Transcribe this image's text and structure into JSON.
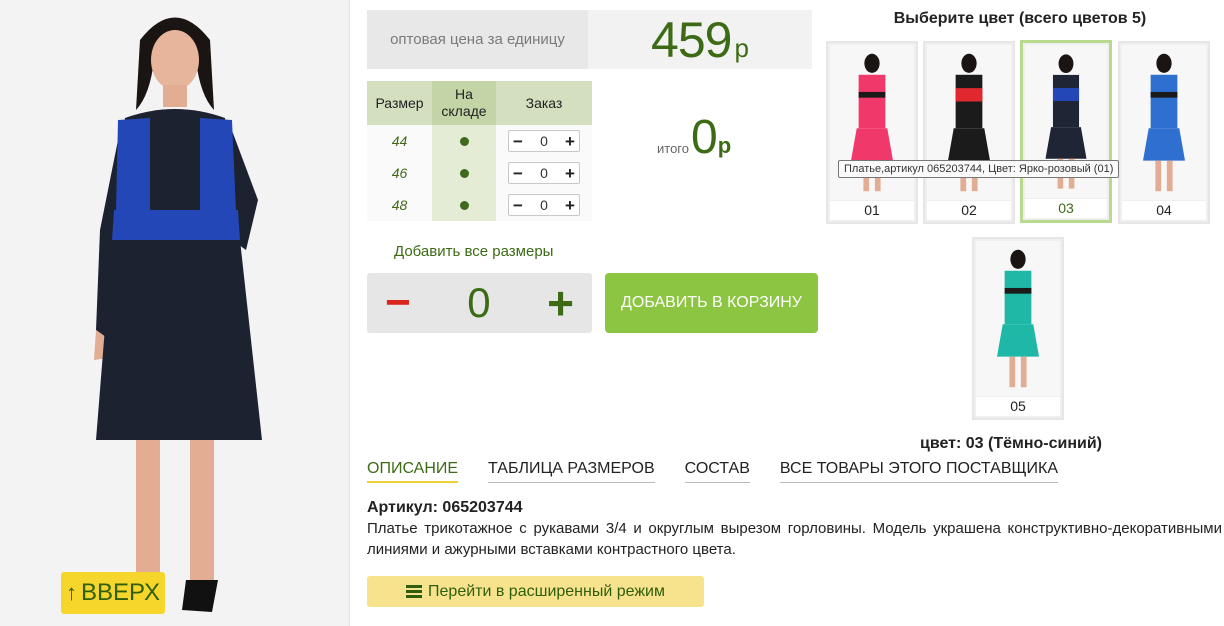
{
  "navigation": {
    "up_label": "ВВЕРХ",
    "up_icon": "arrow-up-icon"
  },
  "price": {
    "label": "оптовая цена за единицу",
    "value": "459",
    "currency": "р"
  },
  "size_table": {
    "headers": {
      "size": "Размер",
      "stock": "На складе",
      "order": "Заказ"
    },
    "rows": [
      {
        "size": "44",
        "in_stock": true,
        "quantity": "0"
      },
      {
        "size": "46",
        "in_stock": true,
        "quantity": "0"
      },
      {
        "size": "48",
        "in_stock": true,
        "quantity": "0"
      }
    ],
    "minus": "−",
    "plus": "+"
  },
  "total": {
    "label": "итого",
    "value": "0",
    "currency": "р"
  },
  "add_all_sizes": "Добавить все размеры",
  "bulk_stepper": {
    "minus": "−",
    "value": "0",
    "plus": "+"
  },
  "cart_button": "ДОБАВИТЬ В КОРЗИНУ",
  "colors": {
    "title": "Выберите цвет (всего цветов 5)",
    "swatches": [
      {
        "label": "01",
        "dress_color": "#f0386b",
        "accent": "#1b1b1b"
      },
      {
        "label": "02",
        "dress_color": "#1b1b1b",
        "accent": "#e0282e"
      },
      {
        "label": "03",
        "dress_color": "#1f2535",
        "accent": "#2447b8",
        "selected": true
      },
      {
        "label": "04",
        "dress_color": "#2e6fcf",
        "accent": "#1b1b1b"
      },
      {
        "label": "05",
        "dress_color": "#1fb7a6",
        "accent": "#1b1b1b"
      }
    ],
    "tooltip": "Платье,артикул 065203744, Цвет: Ярко-розовый (01)",
    "selected_caption": "цвет: 03 (Тёмно-синий)"
  },
  "tabs": [
    {
      "label": "ОПИСАНИЕ",
      "active": true
    },
    {
      "label": "ТАБЛИЦА РАЗМЕРОВ"
    },
    {
      "label": "СОСТАВ"
    },
    {
      "label": "ВСЕ ТОВАРЫ ЭТОГО ПОСТАВЩИКА"
    }
  ],
  "article": "Артикул: 065203744",
  "description": "Платье трикотажное с рукавами 3/4 и округлым вырезом горловины. Модель украшена конструктивно-декоративными линиями и ажурными вставками контрастного цвета.",
  "extended_mode": {
    "label": "Перейти в расширенный режим",
    "icon": "list-icon"
  },
  "theme": {
    "accent_green": "#3d6b15",
    "cart_green": "#8bc541",
    "yellow": "#f6d62b"
  }
}
